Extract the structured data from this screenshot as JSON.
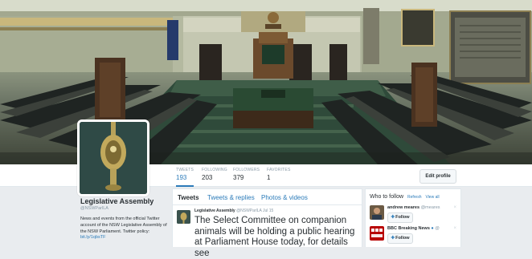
{
  "profile": {
    "name": "Legislative Assembly",
    "handle": "@NSWParlLA",
    "bio": "News and events from the official Twitter account of the NSW Legislative Assembly of the NSW Parliament. Twitter policy:",
    "link": "bit.ly/1qbsTF"
  },
  "stats": [
    {
      "label": "TWEETS",
      "value": "193"
    },
    {
      "label": "FOLLOWING",
      "value": "203"
    },
    {
      "label": "FOLLOWERS",
      "value": "379"
    },
    {
      "label": "FAVORITES",
      "value": "1"
    }
  ],
  "edit_profile_label": "Edit profile",
  "timeline": {
    "tabs": [
      "Tweets",
      "Tweets & replies",
      "Photos & videos"
    ],
    "tweet": {
      "author": "Legislative Assembly",
      "handle": "@NSWParlLA",
      "time": "Jul 15",
      "text": "The Select Committee on companion animals will be holding a public hearing at Parliament House today, for details see"
    }
  },
  "who_to_follow": {
    "title": "Who to follow",
    "refresh": "Refresh",
    "view_all": "View all",
    "suggestions": [
      {
        "name": "andrew meares",
        "handle": "@meares",
        "follow": "Follow"
      },
      {
        "name": "BBC Breaking News",
        "handle": "@",
        "follow": "Follow"
      }
    ]
  },
  "colors": {
    "accent": "#2b7bb9",
    "background": "#e9ecef",
    "chamber_green": "#3d5a3c",
    "bench_leather": "#2a2e2a"
  }
}
